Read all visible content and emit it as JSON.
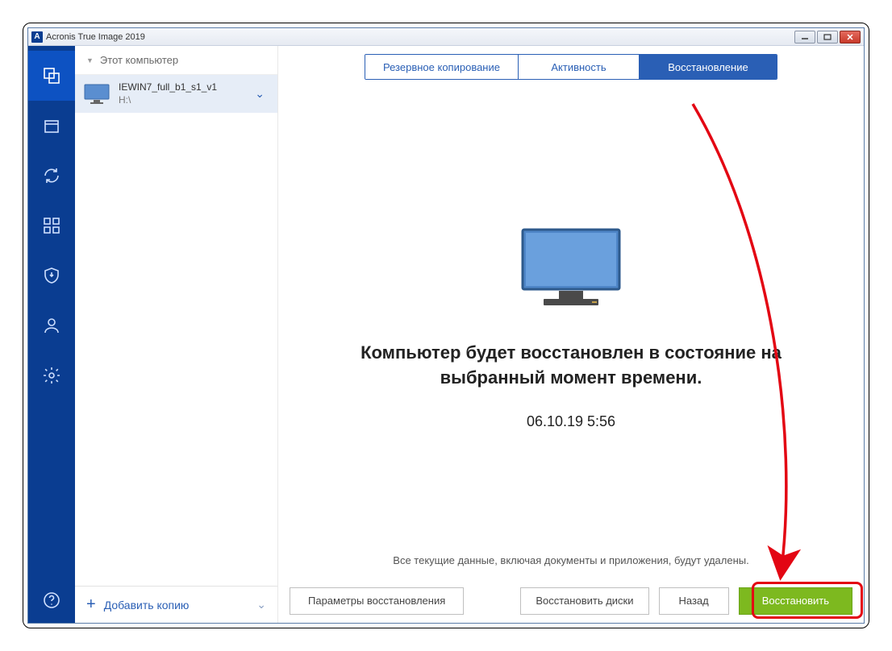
{
  "titlebar": {
    "app_initial": "A",
    "title": "Acronis True Image 2019"
  },
  "sidebar_list": {
    "header_label": "Этот компьютер",
    "backup": {
      "name": "IEWIN7_full_b1_s1_v1",
      "location": "H:\\"
    },
    "add_label": "Добавить копию"
  },
  "tabs": {
    "t0": "Резервное копирование",
    "t1": "Активность",
    "t2": "Восстановление"
  },
  "content": {
    "headline": "Компьютер будет восстановлен в состояние на выбранный момент времени.",
    "timestamp": "06.10.19 5:56",
    "warning": "Все текущие данные, включая документы и приложения, будут удалены."
  },
  "footer": {
    "params": "Параметры восстановления",
    "restore_disks": "Восстановить диски",
    "back": "Назад",
    "restore": "Восстановить"
  }
}
